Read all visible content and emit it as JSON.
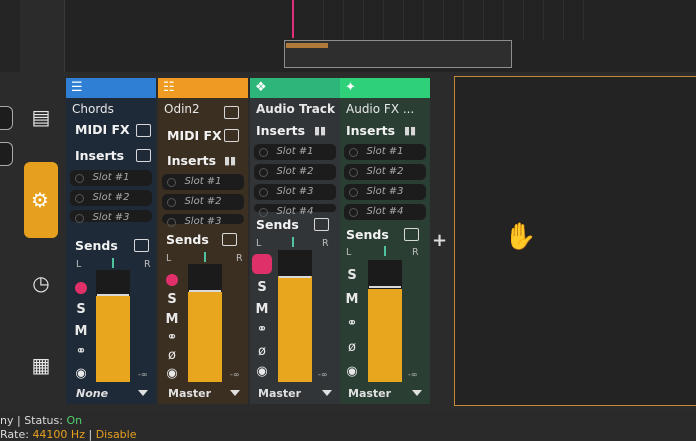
{
  "colors": {
    "accent": "#e7a01e",
    "track_chords": "#2f7fd4",
    "track_odin": "#ef9b23",
    "track_audio": "#2db57a",
    "track_fx": "#2fd07a"
  },
  "toolbar_icons": [
    "tracks-icon",
    "mixer-icon",
    "plugin-icon",
    "grid-icon"
  ],
  "mixer": {
    "tracks": [
      {
        "name": "Chords",
        "color": "#2f7fd4",
        "icon": "midi-icon",
        "midi_fx": "MIDI FX",
        "inserts": "Inserts",
        "slots": [
          "Slot #1",
          "Slot #2",
          "Slot #3"
        ],
        "sends": "Sends",
        "pan_l": "L",
        "pan_r": "R",
        "ctl_s": "S",
        "ctl_m": "M",
        "db": "-∞",
        "output": "None",
        "meter_fill": 0.77
      },
      {
        "name": "Odin2",
        "color": "#ef9b23",
        "icon": "piano-icon",
        "midi_fx": "MIDI FX",
        "inserts": "Inserts",
        "slots": [
          "Slot #1",
          "Slot #2",
          "Slot #3"
        ],
        "sends": "Sends",
        "pan_l": "L",
        "pan_r": "R",
        "ctl_s": "S",
        "ctl_m": "M",
        "ctl_phase": "ø",
        "db": "-∞",
        "output": "Master",
        "meter_fill": 0.76
      },
      {
        "name": "Audio Track",
        "color": "#2db57a",
        "icon": "audio-icon",
        "inserts": "Inserts",
        "slots": [
          "Slot #1",
          "Slot #2",
          "Slot #3",
          "Slot #4"
        ],
        "sends": "Sends",
        "pan_l": "L",
        "pan_r": "R",
        "ctl_s": "S",
        "ctl_m": "M",
        "ctl_phase": "ø",
        "db": "-∞",
        "output": "Master",
        "meter_fill": 0.8
      },
      {
        "name": "Audio FX ...",
        "color": "#2fd07a",
        "icon": "fx-icon",
        "inserts": "Inserts",
        "slots": [
          "Slot #1",
          "Slot #2",
          "Slot #3",
          "Slot #4"
        ],
        "sends": "Sends",
        "pan_l": "L",
        "pan_r": "R",
        "ctl_s": "S",
        "ctl_m": "M",
        "ctl_phase": "ø",
        "db": "-∞",
        "output": "Master",
        "meter_fill": 0.76
      }
    ],
    "add_symbol": "+"
  },
  "status": {
    "line1_prefix": "ny | ",
    "status_label": "Status: ",
    "status_value": "On",
    "line2_prefix": "Rate: ",
    "rate": "44100 Hz",
    "sep": " | ",
    "disable": "Disable"
  }
}
